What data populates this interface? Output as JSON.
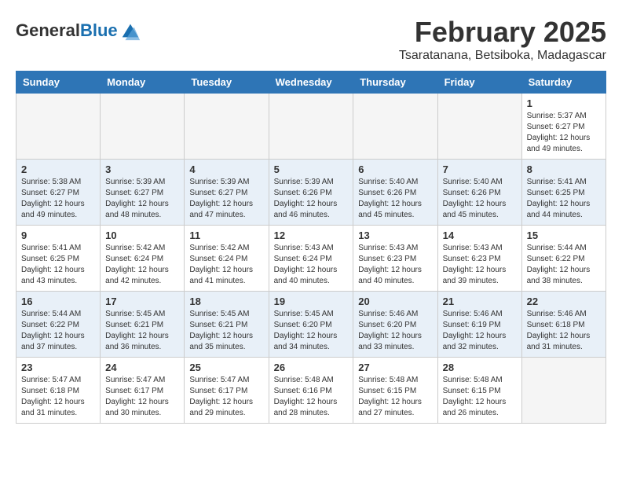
{
  "header": {
    "logo_general": "General",
    "logo_blue": "Blue",
    "month": "February 2025",
    "location": "Tsaratanana, Betsiboka, Madagascar"
  },
  "weekdays": [
    "Sunday",
    "Monday",
    "Tuesday",
    "Wednesday",
    "Thursday",
    "Friday",
    "Saturday"
  ],
  "weeks": [
    [
      {
        "day": "",
        "info": ""
      },
      {
        "day": "",
        "info": ""
      },
      {
        "day": "",
        "info": ""
      },
      {
        "day": "",
        "info": ""
      },
      {
        "day": "",
        "info": ""
      },
      {
        "day": "",
        "info": ""
      },
      {
        "day": "1",
        "info": "Sunrise: 5:37 AM\nSunset: 6:27 PM\nDaylight: 12 hours\nand 49 minutes."
      }
    ],
    [
      {
        "day": "2",
        "info": "Sunrise: 5:38 AM\nSunset: 6:27 PM\nDaylight: 12 hours\nand 49 minutes."
      },
      {
        "day": "3",
        "info": "Sunrise: 5:39 AM\nSunset: 6:27 PM\nDaylight: 12 hours\nand 48 minutes."
      },
      {
        "day": "4",
        "info": "Sunrise: 5:39 AM\nSunset: 6:27 PM\nDaylight: 12 hours\nand 47 minutes."
      },
      {
        "day": "5",
        "info": "Sunrise: 5:39 AM\nSunset: 6:26 PM\nDaylight: 12 hours\nand 46 minutes."
      },
      {
        "day": "6",
        "info": "Sunrise: 5:40 AM\nSunset: 6:26 PM\nDaylight: 12 hours\nand 45 minutes."
      },
      {
        "day": "7",
        "info": "Sunrise: 5:40 AM\nSunset: 6:26 PM\nDaylight: 12 hours\nand 45 minutes."
      },
      {
        "day": "8",
        "info": "Sunrise: 5:41 AM\nSunset: 6:25 PM\nDaylight: 12 hours\nand 44 minutes."
      }
    ],
    [
      {
        "day": "9",
        "info": "Sunrise: 5:41 AM\nSunset: 6:25 PM\nDaylight: 12 hours\nand 43 minutes."
      },
      {
        "day": "10",
        "info": "Sunrise: 5:42 AM\nSunset: 6:24 PM\nDaylight: 12 hours\nand 42 minutes."
      },
      {
        "day": "11",
        "info": "Sunrise: 5:42 AM\nSunset: 6:24 PM\nDaylight: 12 hours\nand 41 minutes."
      },
      {
        "day": "12",
        "info": "Sunrise: 5:43 AM\nSunset: 6:24 PM\nDaylight: 12 hours\nand 40 minutes."
      },
      {
        "day": "13",
        "info": "Sunrise: 5:43 AM\nSunset: 6:23 PM\nDaylight: 12 hours\nand 40 minutes."
      },
      {
        "day": "14",
        "info": "Sunrise: 5:43 AM\nSunset: 6:23 PM\nDaylight: 12 hours\nand 39 minutes."
      },
      {
        "day": "15",
        "info": "Sunrise: 5:44 AM\nSunset: 6:22 PM\nDaylight: 12 hours\nand 38 minutes."
      }
    ],
    [
      {
        "day": "16",
        "info": "Sunrise: 5:44 AM\nSunset: 6:22 PM\nDaylight: 12 hours\nand 37 minutes."
      },
      {
        "day": "17",
        "info": "Sunrise: 5:45 AM\nSunset: 6:21 PM\nDaylight: 12 hours\nand 36 minutes."
      },
      {
        "day": "18",
        "info": "Sunrise: 5:45 AM\nSunset: 6:21 PM\nDaylight: 12 hours\nand 35 minutes."
      },
      {
        "day": "19",
        "info": "Sunrise: 5:45 AM\nSunset: 6:20 PM\nDaylight: 12 hours\nand 34 minutes."
      },
      {
        "day": "20",
        "info": "Sunrise: 5:46 AM\nSunset: 6:20 PM\nDaylight: 12 hours\nand 33 minutes."
      },
      {
        "day": "21",
        "info": "Sunrise: 5:46 AM\nSunset: 6:19 PM\nDaylight: 12 hours\nand 32 minutes."
      },
      {
        "day": "22",
        "info": "Sunrise: 5:46 AM\nSunset: 6:18 PM\nDaylight: 12 hours\nand 31 minutes."
      }
    ],
    [
      {
        "day": "23",
        "info": "Sunrise: 5:47 AM\nSunset: 6:18 PM\nDaylight: 12 hours\nand 31 minutes."
      },
      {
        "day": "24",
        "info": "Sunrise: 5:47 AM\nSunset: 6:17 PM\nDaylight: 12 hours\nand 30 minutes."
      },
      {
        "day": "25",
        "info": "Sunrise: 5:47 AM\nSunset: 6:17 PM\nDaylight: 12 hours\nand 29 minutes."
      },
      {
        "day": "26",
        "info": "Sunrise: 5:48 AM\nSunset: 6:16 PM\nDaylight: 12 hours\nand 28 minutes."
      },
      {
        "day": "27",
        "info": "Sunrise: 5:48 AM\nSunset: 6:15 PM\nDaylight: 12 hours\nand 27 minutes."
      },
      {
        "day": "28",
        "info": "Sunrise: 5:48 AM\nSunset: 6:15 PM\nDaylight: 12 hours\nand 26 minutes."
      },
      {
        "day": "",
        "info": ""
      }
    ]
  ]
}
